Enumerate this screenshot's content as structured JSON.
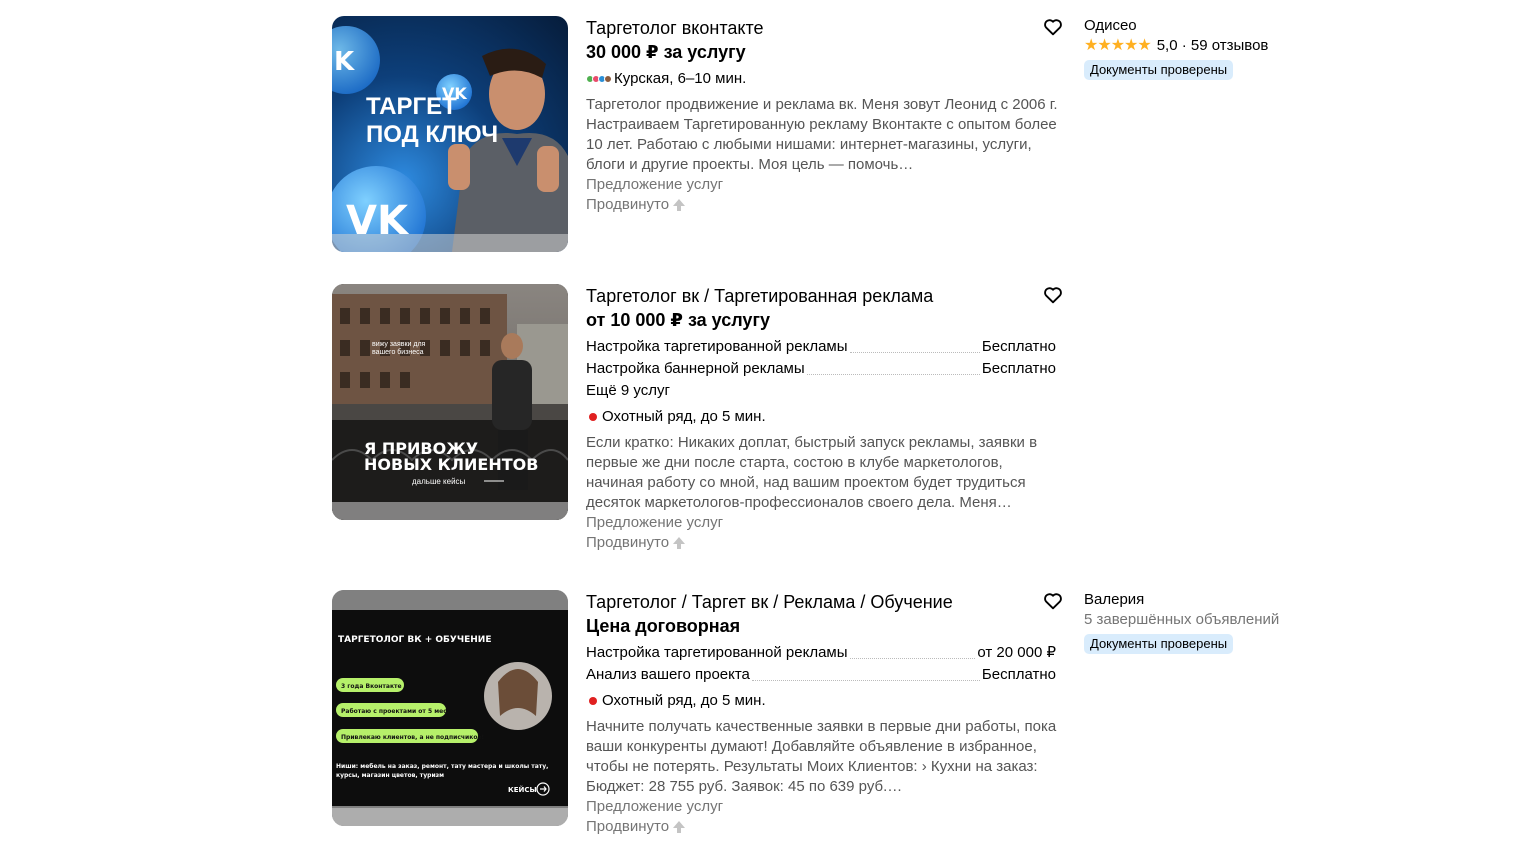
{
  "listings": [
    {
      "title": "Таргетолог вконтакте",
      "price": "30 000 ₽ за услугу",
      "location": "Курская, 6–10 мин.",
      "metro_colors": [
        "#4fb04f",
        "#e94b6b",
        "#2b8fd6",
        "#8c5b3c"
      ],
      "description": "Таргетолог продвижение и реклама вк. Меня зовут Леонид с 2006 г. Настраиваем Таргетированную рекламу Вконтакте с опытом более 10 лет. Работаю с любыми нишами: интернет-магазины, услуги, блоги и другие проекты. Моя цель — помочь…",
      "category": "Предложение услуг",
      "promoted": "Продвинуто",
      "image": {
        "line1": "ТАРГЕТ",
        "line2": "ПОД КЛЮЧ"
      },
      "seller": {
        "name": "Одисео",
        "stars": "★★★★★",
        "rating": "5,0 · 59 отзывов",
        "badge": "Документы проверены"
      }
    },
    {
      "title": "Таргетолог вк / Таргетированная реклама",
      "price": "от 10 000 ₽ за услугу",
      "services": [
        {
          "name": "Настройка таргетированной рекламы",
          "price": "Бесплатно"
        },
        {
          "name": "Настройка баннерной рекламы",
          "price": "Бесплатно"
        }
      ],
      "more": "Ещё 9 услуг",
      "location": "Охотный ряд, до 5 мин.",
      "description": "Если кратко: Никаких доплат, быстрый запуск рекламы, заявки в первые же дни после старта, состою в клубе маркетологов, начиная работу со мной, над вашим проектом будет трудиться десяток маркетологов-профессионалов своего дела. Меня…",
      "category": "Предложение услуг",
      "promoted": "Продвинуто",
      "image": {
        "small1": "вижу заявки для",
        "small2": "вашего бизнеса",
        "big1": "Я ПРИВОЖУ",
        "big2": "НОВЫХ КЛИЕНТОВ",
        "foot": "дальше кейсы"
      }
    },
    {
      "title": "Таргетолог / Таргет вк / Реклама / Обучение",
      "price": "Цена договорная",
      "services": [
        {
          "name": "Настройка таргетированной рекламы",
          "price": "от 20 000 ₽"
        },
        {
          "name": "Анализ вашего проекта",
          "price": "Бесплатно"
        }
      ],
      "location": "Охотный ряд, до 5 мин.",
      "description": "Начните получать качественные заявки в первые дни работы, пока ваши конкуренты думают! Добавляйте объявление в избранное, чтобы не потерять. Результаты Моих Клиентов: › Кухни на заказ: Бюджет: 28 755 руб. Заявок: 45 по 639 руб.…",
      "category": "Предложение услуг",
      "promoted": "Продвинуто",
      "image": {
        "heading": "ТАРГЕТОЛОГ ВК + ОБУЧЕНИЕ",
        "pill1": "3 года Вконтакте",
        "pill2": "Работаю с проектами от 5 мес.",
        "pill3": "Привлекаю клиентов, а не подписчиков!",
        "niches": "Ниши: мебель на заказ, ремонт, тату мастера и школы тату, курсы, магазин цветов, туризм",
        "foot": "КЕЙСЫ"
      },
      "seller": {
        "name": "Валерия",
        "sub": "5 завершённых объявлений",
        "badge": "Документы проверены"
      }
    }
  ],
  "colors": {
    "badge_bg": "#d9ecfc",
    "star": "#ffb021",
    "muted_text": "#757575",
    "status_red": "#e02020"
  }
}
